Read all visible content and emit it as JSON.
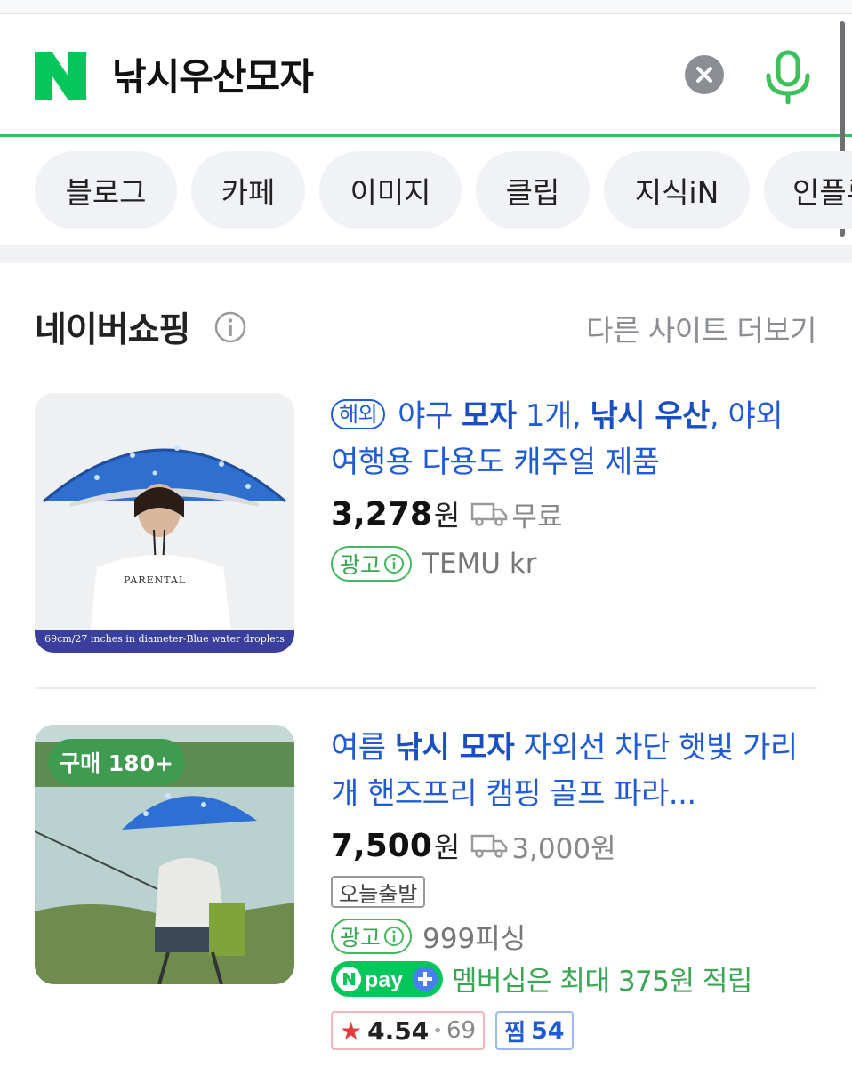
{
  "search": {
    "query": "낚시우산모자"
  },
  "tabs": [
    {
      "label": "블로그"
    },
    {
      "label": "카페"
    },
    {
      "label": "이미지"
    },
    {
      "label": "클립"
    },
    {
      "label": "지식iN"
    },
    {
      "label": "인플루"
    }
  ],
  "shopping": {
    "title": "네이버쇼핑",
    "more_label": "다른 사이트 더보기"
  },
  "products": [
    {
      "overseas_badge": "해외",
      "title_parts": [
        "야구 ",
        "모자",
        " 1개, ",
        "낚시 우산",
        ", 야외 여행용 다용도 캐주얼 제품"
      ],
      "price": "3,278",
      "currency": "원",
      "shipping": "무료",
      "ad_label": "광고",
      "seller": "TEMU kr",
      "thumb_caption": "69cm/27 inches in diameter-Blue water droplets",
      "shirt_text": "PARENTAL"
    },
    {
      "buy_badge": "구매 180+",
      "title_parts": [
        "여름 ",
        "낚시 모자",
        " 자외선 차단 햇빛 가리개 핸즈프리 캠핑 골프 파라..."
      ],
      "price": "7,500",
      "currency": "원",
      "shipping": "3,000원",
      "today_badge": "오늘출발",
      "ad_label": "광고",
      "seller": "999피싱",
      "npay_text": "멤버십은 최대 375원 적립",
      "rating": "4.54",
      "reviews": "69",
      "zzim_label": "찜",
      "zzim_count": "54"
    }
  ],
  "colors": {
    "naver_green": "#03c75a",
    "link_blue": "#1f5bd6",
    "ad_green": "#3aa653",
    "star_red": "#ea3b3b"
  }
}
